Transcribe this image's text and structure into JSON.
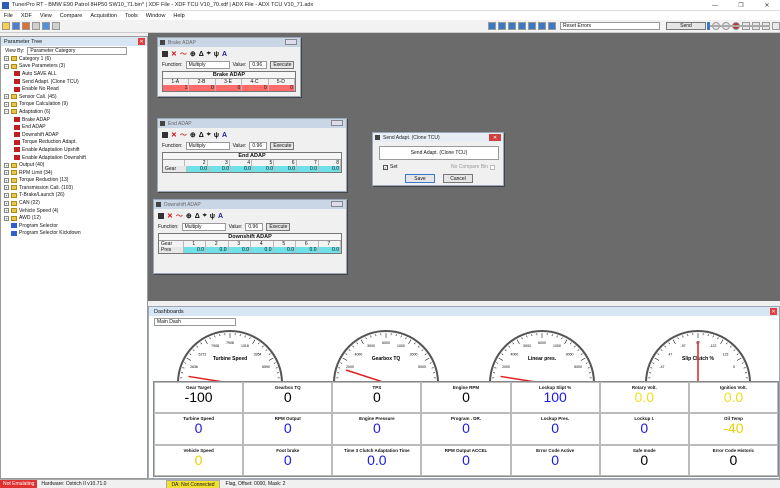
{
  "app": {
    "title": "TunerPro RT - BMW E90 Patrol 8HP50 SW10_71.bin* | XDF File - XDF TCU V10_70.xdf | ADX File - ADX TCU V10_71.adx"
  },
  "window_controls": [
    "—",
    "❐",
    "✕"
  ],
  "menu": [
    "File",
    "XDF",
    "View",
    "Compare",
    "Acquisition",
    "Tools",
    "Window",
    "Help"
  ],
  "toolbar": {
    "reset_select": "Reset Errors",
    "send_label": "Send"
  },
  "parameter_tree": {
    "title": "Parameter Tree",
    "view_by_label": "View By:",
    "view_by_value": "Parameter Category",
    "items": [
      {
        "label": "Category 1 (6)",
        "kind": "folder",
        "expander": "+",
        "indent": 0
      },
      {
        "label": "Save Parameters (3)",
        "kind": "folder",
        "expander": "−",
        "indent": 0
      },
      {
        "label": "Auto SAVE ALL",
        "kind": "item",
        "indent": 1
      },
      {
        "label": "Send Adapt. (Clone TCU)",
        "kind": "item",
        "indent": 1
      },
      {
        "label": "Enable No Read",
        "kind": "item",
        "indent": 1
      },
      {
        "label": "Sensor Cali. (45)",
        "kind": "folder",
        "expander": "+",
        "indent": 0
      },
      {
        "label": "Torque Calculation (9)",
        "kind": "folder",
        "expander": "+",
        "indent": 0
      },
      {
        "label": "Adaptation (6)",
        "kind": "folder",
        "expander": "−",
        "indent": 0
      },
      {
        "label": "Brake ADAP",
        "kind": "item",
        "indent": 1
      },
      {
        "label": "End ADAP",
        "kind": "item",
        "indent": 1
      },
      {
        "label": "Downshift ADAP",
        "kind": "item",
        "indent": 1
      },
      {
        "label": "Torque Reduction Adapt.",
        "kind": "item",
        "indent": 1
      },
      {
        "label": "Enable Adaptation Upshift",
        "kind": "item",
        "indent": 1
      },
      {
        "label": "Enable Adaptation Downshift",
        "kind": "item",
        "indent": 1
      },
      {
        "label": "Output (40)",
        "kind": "folder",
        "expander": "+",
        "indent": 0
      },
      {
        "label": "RPM Limit (34)",
        "kind": "folder",
        "expander": "+",
        "indent": 0
      },
      {
        "label": "Torque Reduction (13)",
        "kind": "folder",
        "expander": "+",
        "indent": 0
      },
      {
        "label": "Transmission Cali. (103)",
        "kind": "folder",
        "expander": "+",
        "indent": 0
      },
      {
        "label": "T-Brake/Launch (26)",
        "kind": "folder",
        "expander": "+",
        "indent": 0
      },
      {
        "label": "CAN (22)",
        "kind": "folder",
        "expander": "+",
        "indent": 0
      },
      {
        "label": "Vehicle Speed (4)",
        "kind": "folder",
        "expander": "+",
        "indent": 0
      },
      {
        "label": "AWD (12)",
        "kind": "folder",
        "expander": "+",
        "indent": 0
      },
      {
        "label": "Program Selector",
        "kind": "table",
        "indent": 0
      },
      {
        "label": "Program Selector Kickdown",
        "kind": "table",
        "indent": 0
      }
    ]
  },
  "brake_adap": {
    "title": "Brake ADAP",
    "function_label": "Function:",
    "function_value": "Multiply",
    "value_label": "Value:",
    "value": "0.96",
    "execute": "Execute",
    "table_title": "Brake ADAP",
    "headers": [
      "1-A",
      "2-B",
      "3-E",
      "4-C",
      "5-D"
    ],
    "values": [
      "1",
      "0",
      "0",
      "0",
      "0"
    ]
  },
  "end_adap": {
    "title": "End ADAP",
    "function_label": "Function:",
    "function_value": "Multiply",
    "value_label": "Value:",
    "value": "0.96",
    "execute": "Execute",
    "table_title": "End ADAP",
    "row_label": "Gear",
    "headers": [
      "2",
      "3",
      "4",
      "5",
      "6",
      "7",
      "8"
    ],
    "values": [
      "0.0",
      "0.0",
      "0.0",
      "0.0",
      "0.0",
      "0.0",
      "0.0"
    ]
  },
  "downshift_adap": {
    "title": "Downshift ADAP",
    "function_label": "Function:",
    "function_value": "Multiply",
    "value_label": "Value:",
    "value": "0.96",
    "execute": "Execute",
    "table_title": "Downshift ADAP",
    "col_label": "Gear",
    "row_label": "Pres",
    "headers": [
      "1",
      "2",
      "3",
      "4",
      "5",
      "6",
      "7"
    ],
    "values": [
      "0.0",
      "0.0",
      "0.0",
      "0.0",
      "0.0",
      "0.0",
      "0.0"
    ]
  },
  "send_dialog": {
    "title": "Send Adapt. (Clone TCU)",
    "item": "Send Adapt. (Clone TCU)",
    "set_label": "Set",
    "no_compare_label": "No Compare Bin",
    "save": "Save",
    "cancel": "Cancel"
  },
  "dashboard": {
    "title": "Dashboards",
    "select": "Main Dash",
    "gauges": [
      {
        "title": "Turbine Speed",
        "ticks": [
          "2636",
          "5272",
          "7908",
          "7908"
        ],
        "small": [
          "1318",
          "3954",
          "6590"
        ],
        "needle": 0.05
      },
      {
        "title": "Gearbox TQ",
        "ticks": [
          "2000",
          "4000",
          "3000",
          "6000"
        ],
        "small": [
          "1000",
          "3000",
          "5000"
        ],
        "needle": 0.1
      },
      {
        "title": "Linear pres.",
        "ticks": [
          "2000",
          "4000",
          "3000",
          "6000"
        ],
        "small": [
          "1000",
          "3000",
          "5000"
        ],
        "needle": 0.05
      },
      {
        "title": "Slip Clutch %",
        "ticks": [
          "-47",
          "47",
          "-97",
          "97",
          "-122",
          "122"
        ],
        "small": [
          "0"
        ],
        "needle": 0.5
      }
    ],
    "cells": [
      {
        "label": "Gear Target",
        "value": "-100",
        "color": "#000000"
      },
      {
        "label": "Gearbox TQ",
        "value": "0",
        "color": "#000000"
      },
      {
        "label": "TPS",
        "value": "0",
        "color": "#000000"
      },
      {
        "label": "Engine RPM",
        "value": "0",
        "color": "#000000"
      },
      {
        "label": "Lockup Slipt %",
        "value": "100",
        "color": "#1a1ae6"
      },
      {
        "label": "Rotary Volt.",
        "value": "0.0",
        "color": "#f0e020"
      },
      {
        "label": "Ignition Volt.",
        "value": "0.0",
        "color": "#f0e020"
      },
      {
        "label": "Turbine Speed",
        "value": "0",
        "color": "#1a1ae6"
      },
      {
        "label": "RPM Output",
        "value": "0",
        "color": "#1a1ae6"
      },
      {
        "label": "Engine Pressure",
        "value": "0",
        "color": "#1a1ae6"
      },
      {
        "label": "Program . DR.",
        "value": "0",
        "color": "#1a1ae6"
      },
      {
        "label": "Lockup Pres.",
        "value": "0",
        "color": "#1a1ae6"
      },
      {
        "label": "Lockup I.",
        "value": "0",
        "color": "#1a1ae6"
      },
      {
        "label": "Oil Temp",
        "value": "-40",
        "color": "#f0d000"
      },
      {
        "label": "Vehicle Speed",
        "value": "0",
        "color": "#f0d000"
      },
      {
        "label": "Foot brake",
        "value": "0",
        "color": "#1a1ae6"
      },
      {
        "label": "Time 3 Clutch Adaptation Time",
        "value": "0.0",
        "color": "#1a1ae6"
      },
      {
        "label": "RPM Output ACCEL",
        "value": "0",
        "color": "#1a1ae6"
      },
      {
        "label": "Error Code Active",
        "value": "0",
        "color": "#1a1ae6"
      },
      {
        "label": "Safe mode",
        "value": "0",
        "color": "#000000"
      },
      {
        "label": "Error Code Historic",
        "value": "0",
        "color": "#000000"
      }
    ]
  },
  "status": {
    "emulating": "Not Emulating",
    "hardware": "Hardware: Ostrich II v10.71.0",
    "da": "DA: Not Connected",
    "flag": "Flag, Offset: 0000, Mask: 2"
  }
}
